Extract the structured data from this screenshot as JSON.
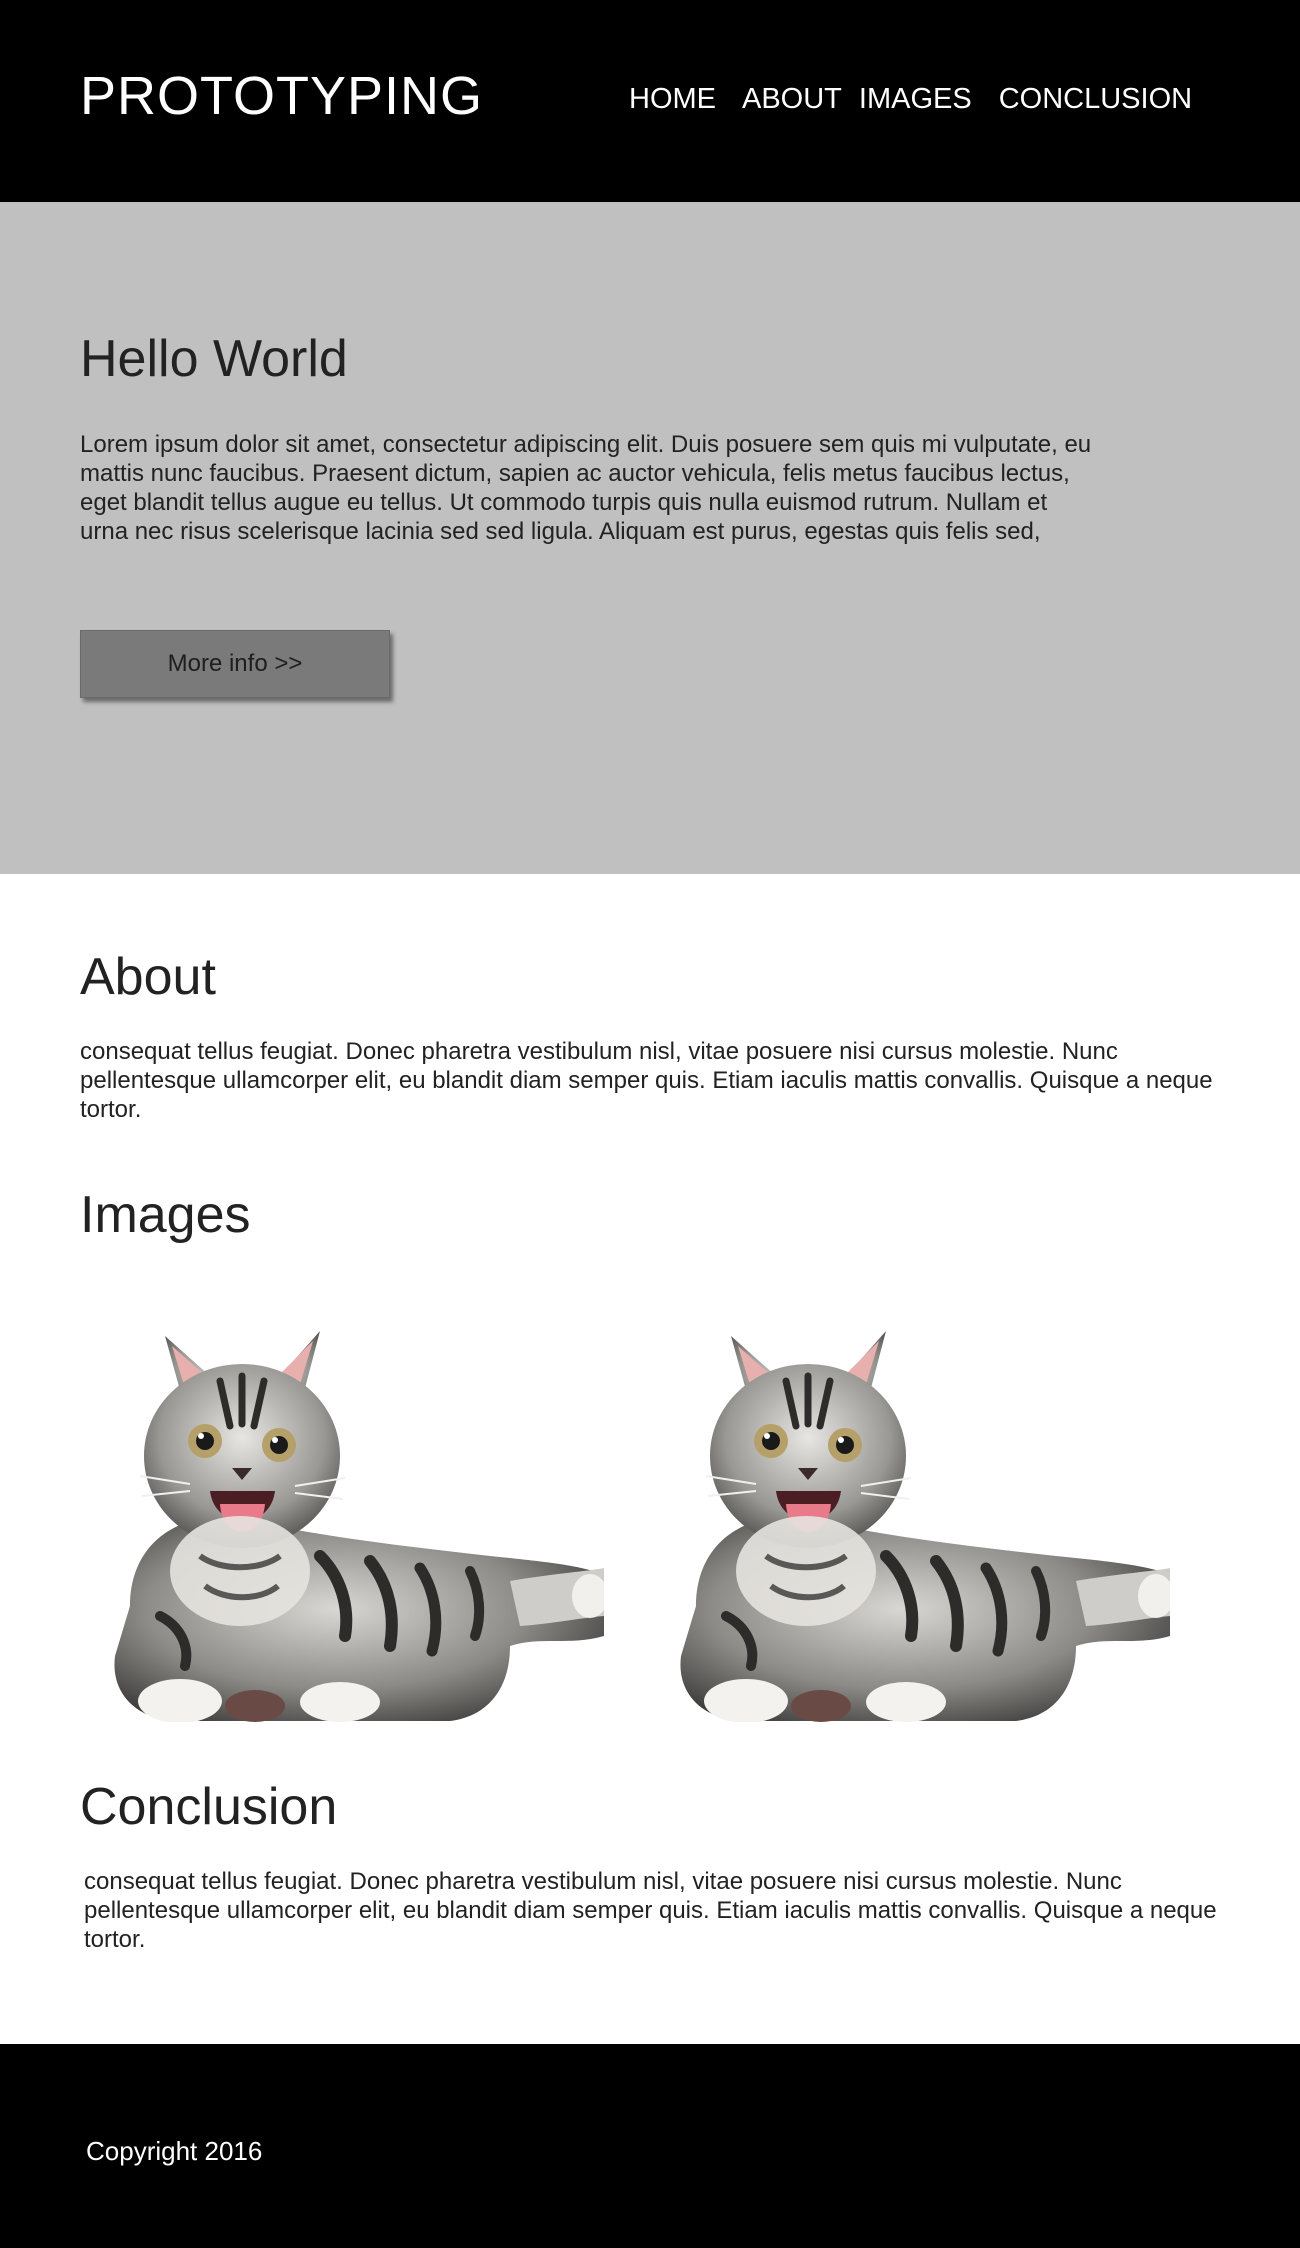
{
  "header": {
    "brand": "PROTOTYPING",
    "nav": [
      "HOME",
      "ABOUT",
      "IMAGES",
      "CONCLUSION"
    ]
  },
  "hero": {
    "title": "Hello World",
    "text": "Lorem ipsum dolor sit amet, consectetur adipiscing elit. Duis posuere sem quis mi vulputate, eu mattis nunc faucibus. Praesent dictum, sapien ac auctor vehicula, felis metus faucibus lectus, eget blandit tellus augue eu tellus. Ut commodo turpis quis nulla euismod rutrum. Nullam et urna nec risus scelerisque lacinia sed sed ligula. Aliquam est purus, egestas quis felis sed,",
    "button_label": "More info >>"
  },
  "about": {
    "title": "About",
    "text": "consequat tellus feugiat. Donec pharetra vestibulum nisl, vitae posuere nisi cursus molestie. Nunc pellentesque ullamcorper elit, eu blandit diam semper quis. Etiam iaculis mattis convallis. Quisque a neque tortor."
  },
  "images": {
    "title": "Images",
    "items": [
      "kitten-photo",
      "kitten-photo"
    ]
  },
  "conclusion": {
    "title": "Conclusion",
    "text": "consequat tellus feugiat. Donec pharetra vestibulum nisl, vitae posuere nisi cursus molestie. Nunc pellentesque ullamcorper elit, eu blandit diam semper quis. Etiam iaculis mattis convallis. Quisque a neque tortor."
  },
  "footer": {
    "copyright": "Copyright 2016"
  },
  "colors": {
    "header_bg": "#000000",
    "hero_bg": "#c0c0c0",
    "button_bg": "#7a7a7a",
    "footer_bg": "#000000",
    "text": "#222222"
  }
}
